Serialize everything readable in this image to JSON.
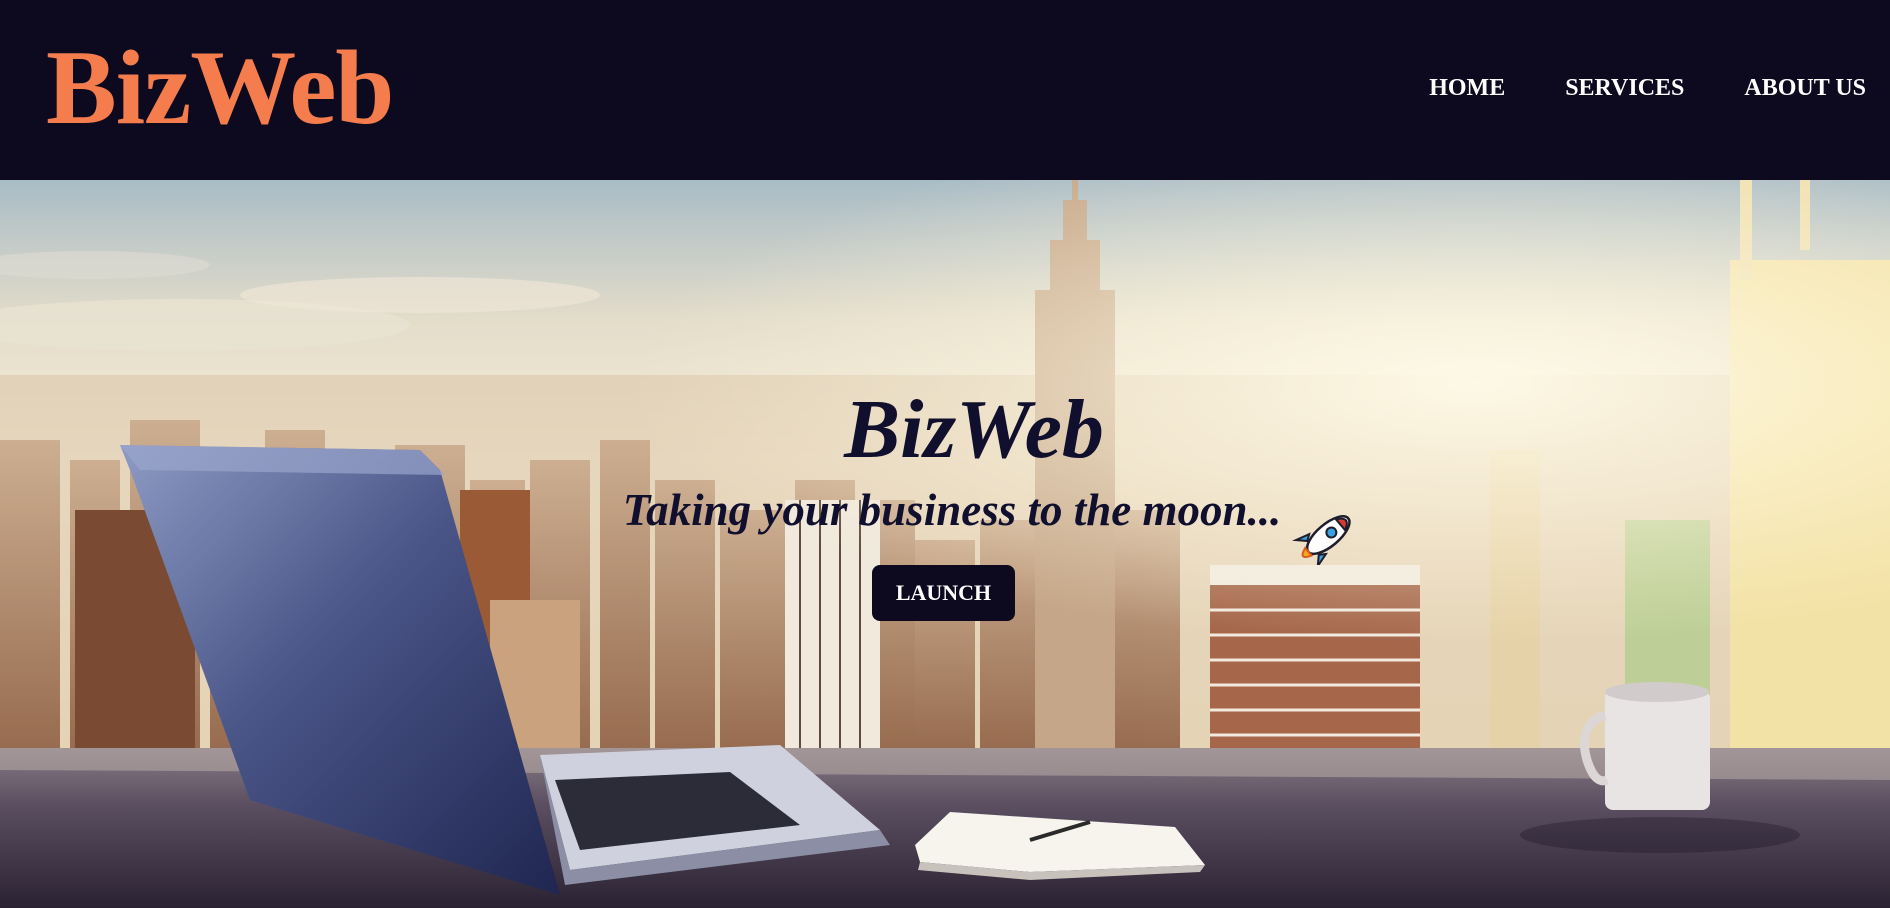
{
  "header": {
    "logo": "BizWeb",
    "nav": [
      {
        "label": "HOME"
      },
      {
        "label": "SERVICES"
      },
      {
        "label": "ABOUT US"
      }
    ]
  },
  "hero": {
    "title": "BizWeb",
    "subtitle": "Taking your business to the moon...",
    "subtitle_icon": "rocket-icon",
    "button_label": "LAUNCH",
    "background_image": "city-skyline-office-desk-photo"
  },
  "colors": {
    "header_bg": "#0d0a1f",
    "logo": "#f47c4d",
    "nav_text": "#ffffff",
    "hero_text": "#10102e",
    "button_bg": "#0d0a1f",
    "button_text": "#ffffff"
  }
}
